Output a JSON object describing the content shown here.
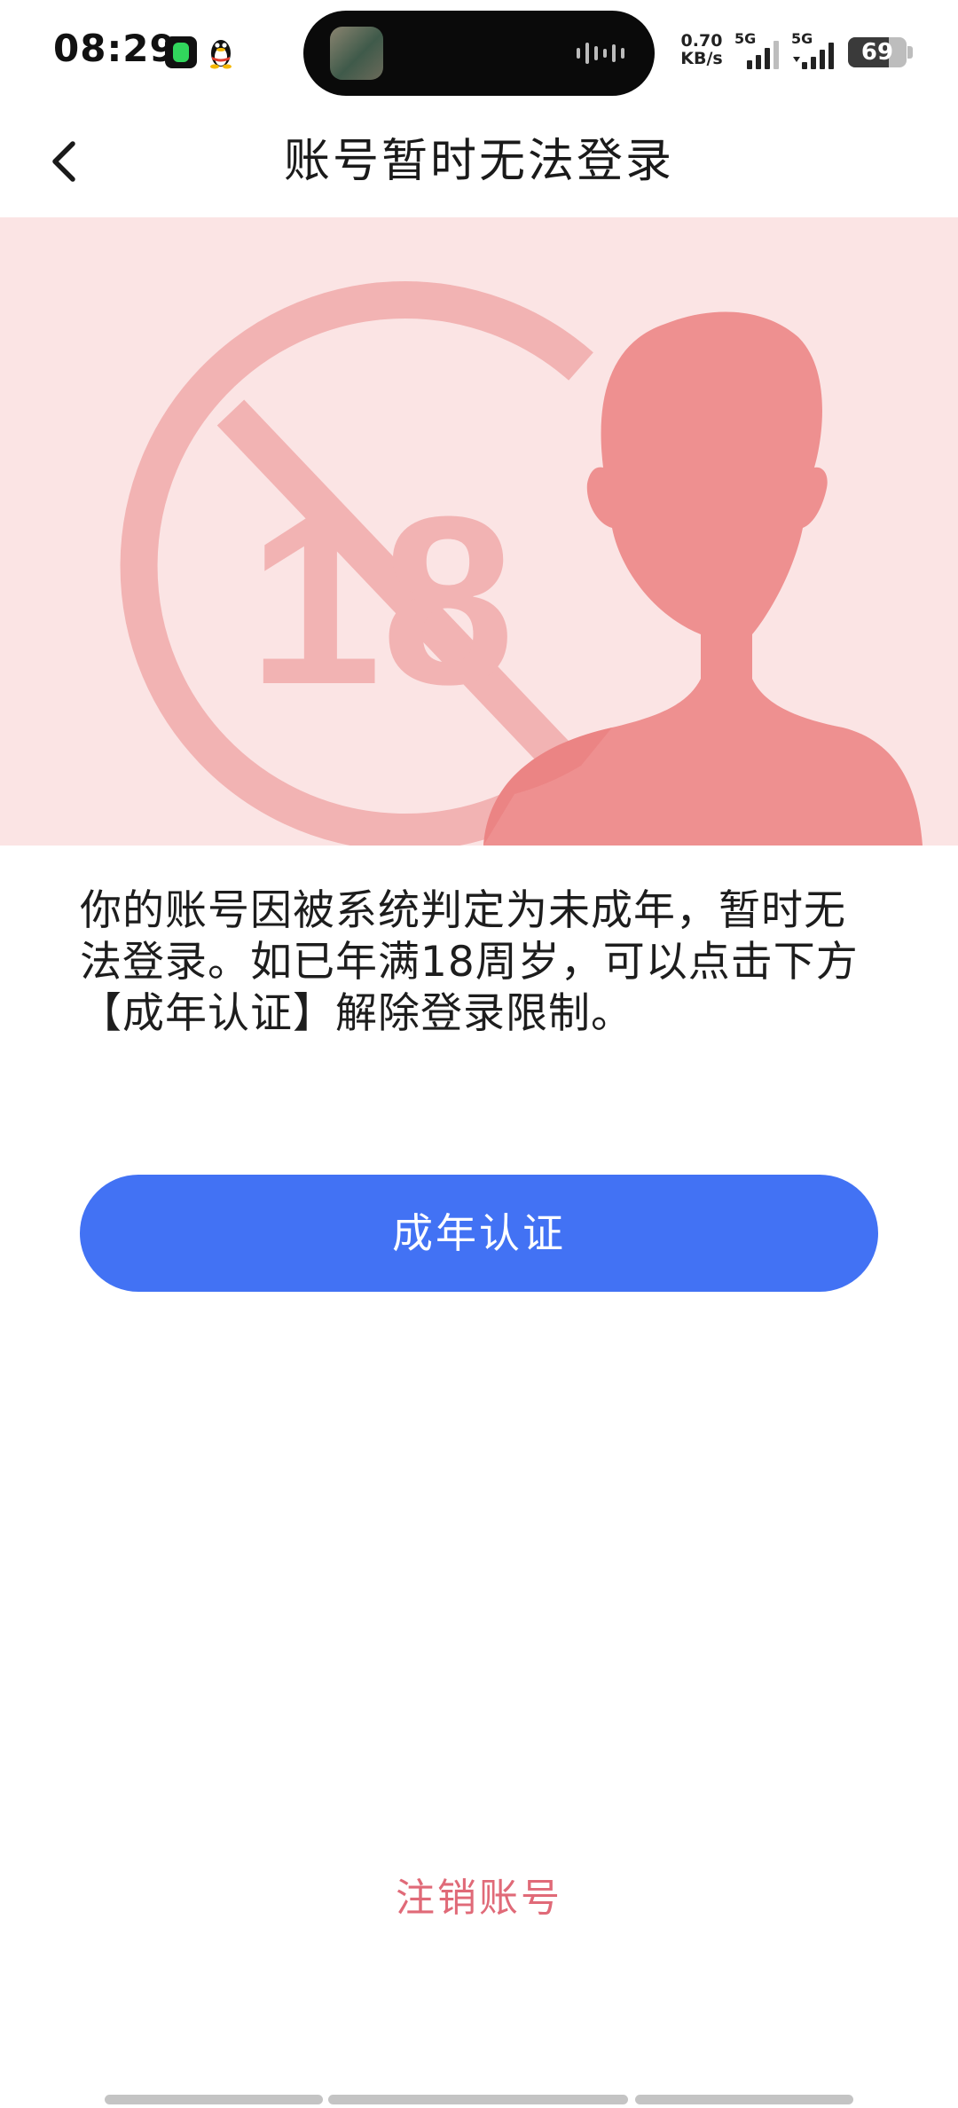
{
  "status_bar": {
    "time": "08:29",
    "net_speed_value": "0.70",
    "net_speed_unit": "KB/s",
    "signal_1_label": "5G",
    "signal_2_label": "5G",
    "battery_level": "69",
    "battery_fraction": 0.69,
    "icons": [
      "app-green-icon",
      "qq-penguin-icon",
      "island-thumbnail",
      "audio-wave-icon",
      "signal-icon",
      "battery-icon"
    ]
  },
  "header": {
    "title": "账号暂时无法登录",
    "back_icon": "chevron-left-icon"
  },
  "banner": {
    "badge_text": "18",
    "icons": [
      "no-under-18-icon",
      "person-silhouette-icon"
    ],
    "colors": {
      "background": "#fbe4e4",
      "badge": "#f2b3b3",
      "person": "#ee9090"
    }
  },
  "main": {
    "message": "你的账号因被系统判定为未成年，暂时无法登录。如已年满18周岁，可以点击下方【成年认证】解除登录限制。",
    "verify_button_label": "成年认证",
    "cancel_account_label": "注销账号"
  },
  "colors": {
    "primary": "#4272f4",
    "danger_text": "#e06a78"
  }
}
